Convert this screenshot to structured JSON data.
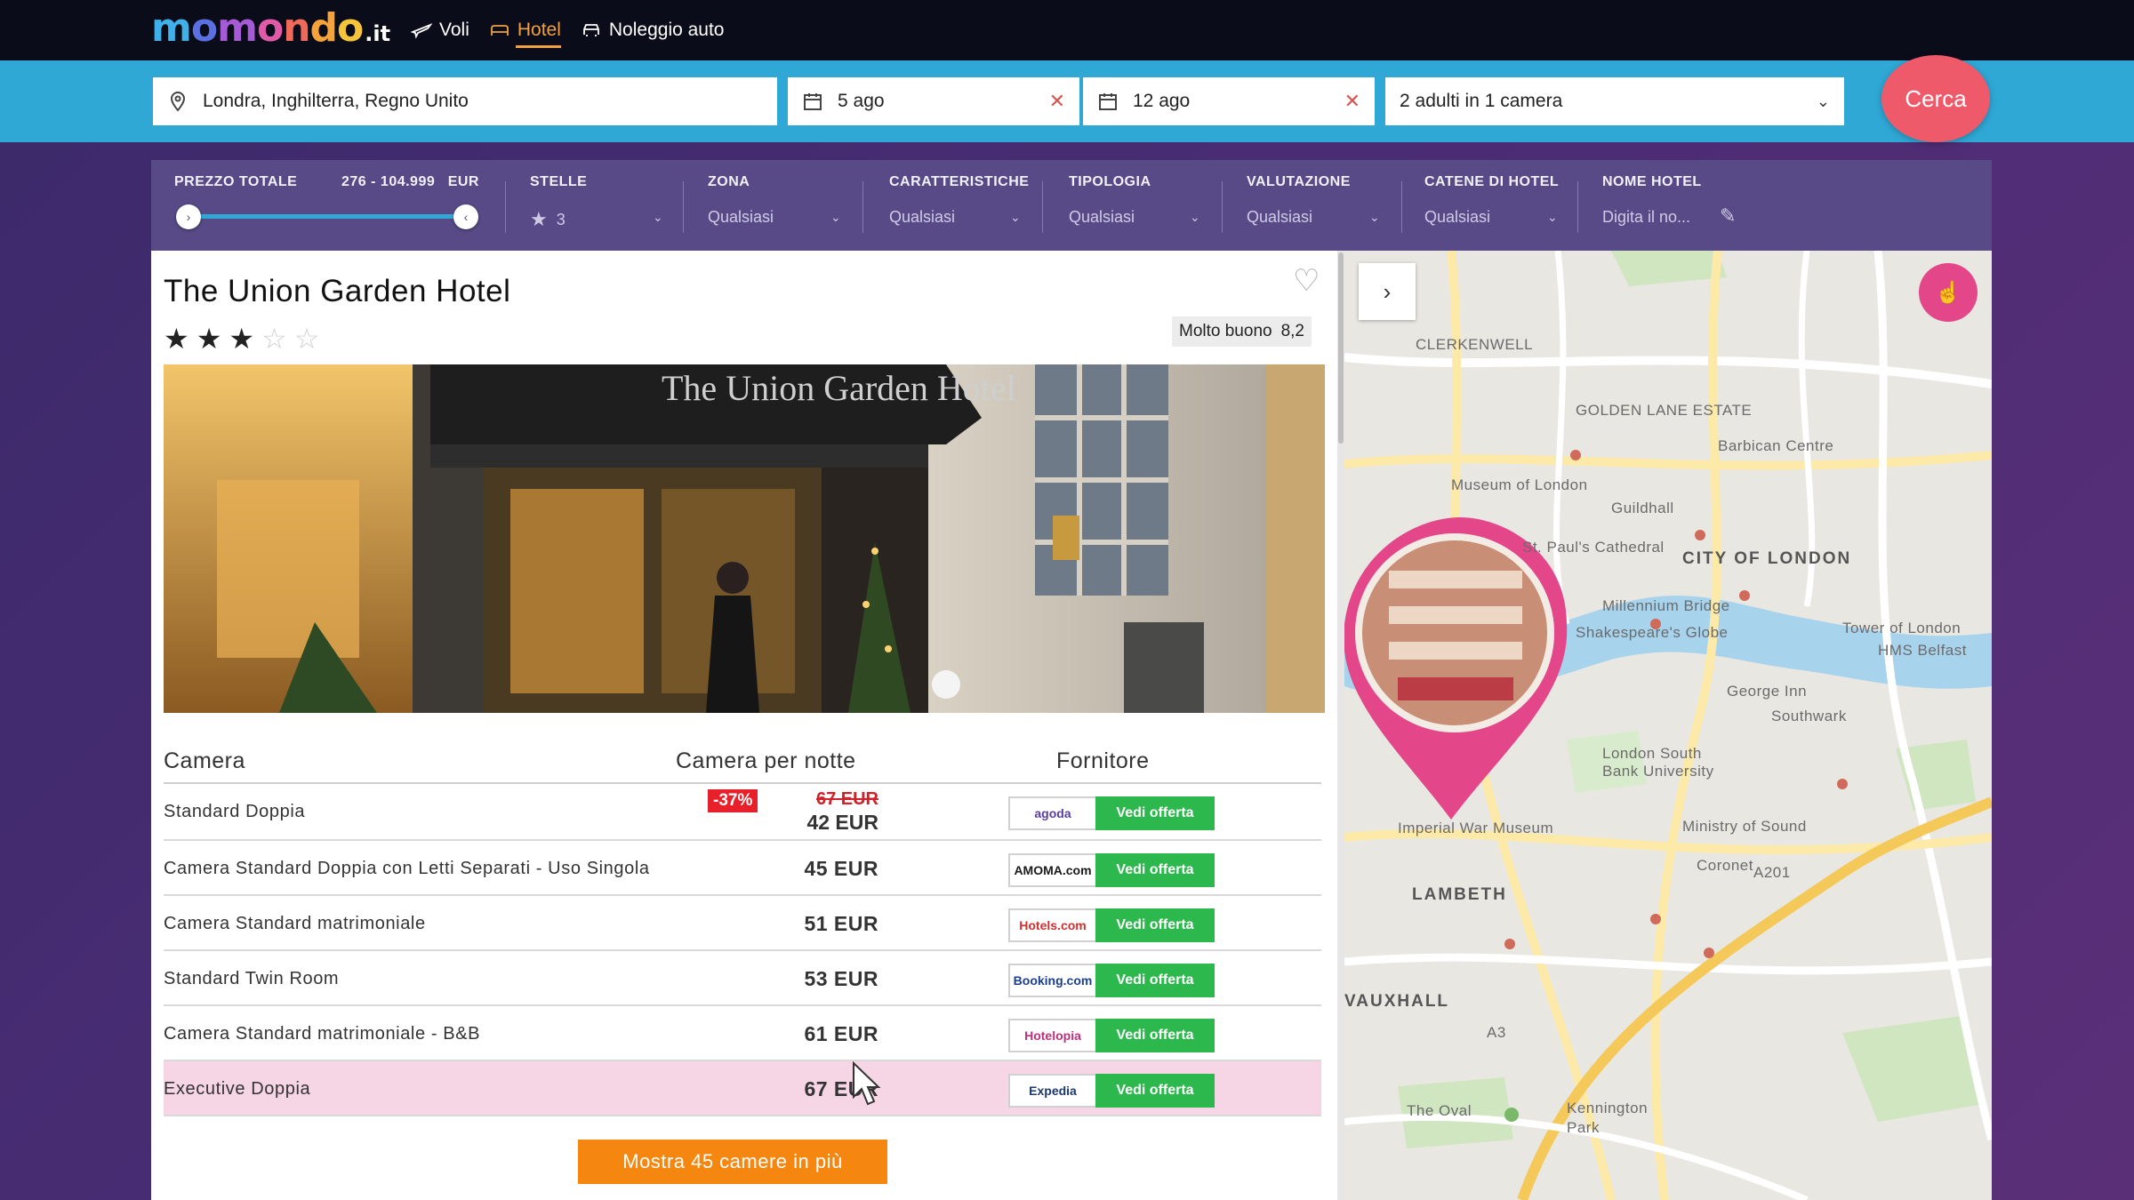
{
  "brand": {
    "logo_main": "momondo",
    "logo_tld": ".it"
  },
  "nav": {
    "items": [
      {
        "label": "Voli",
        "icon": "plane-icon"
      },
      {
        "label": "Hotel",
        "icon": "bed-icon",
        "active": true
      },
      {
        "label": "Noleggio auto",
        "icon": "car-icon"
      }
    ]
  },
  "search": {
    "destination": "Londra, Inghilterra, Regno Unito",
    "checkin": "5 ago",
    "checkout": "12 ago",
    "guests": "2 adulti in 1 camera",
    "button": "Cerca"
  },
  "filters": {
    "price": {
      "label": "PREZZO TOTALE",
      "range": "276 - 104.999",
      "currency": "EUR"
    },
    "stars": {
      "label": "STELLE",
      "value": "3"
    },
    "zone": {
      "label": "ZONA",
      "value": "Qualsiasi"
    },
    "features": {
      "label": "CARATTERISTICHE",
      "value": "Qualsiasi"
    },
    "type": {
      "label": "TIPOLOGIA",
      "value": "Qualsiasi"
    },
    "rating": {
      "label": "VALUTAZIONE",
      "value": "Qualsiasi"
    },
    "chains": {
      "label": "CATENE DI HOTEL",
      "value": "Qualsiasi"
    },
    "name": {
      "label": "NOME HOTEL",
      "placeholder": "Digita il no..."
    }
  },
  "hotel": {
    "name": "The Union Garden Hotel",
    "stars": 3,
    "rating_text": "Molto buono",
    "rating_score": "8,2",
    "sign_text": "The Union Garden Hotel"
  },
  "rooms": {
    "headers": {
      "room": "Camera",
      "price": "Camera per notte",
      "provider": "Fornitore"
    },
    "offer_label": "Vedi offerta",
    "list": [
      {
        "name": "Standard Doppia",
        "discount": "-37%",
        "old_price": "67 EUR",
        "price": "42 EUR",
        "provider": "agoda"
      },
      {
        "name": "Camera Standard Doppia con Letti Separati - Uso Singola",
        "price": "45 EUR",
        "provider": "AMOMA.com"
      },
      {
        "name": "Camera Standard matrimoniale",
        "price": "51 EUR",
        "provider": "Hotels.com"
      },
      {
        "name": "Standard Twin Room",
        "price": "53 EUR",
        "provider": "Booking.com"
      },
      {
        "name": "Camera Standard matrimoniale - B&B",
        "price": "61 EUR",
        "provider": "Hotelopia"
      },
      {
        "name": "Executive Doppia",
        "price": "67 EUR",
        "provider": "Expedia"
      }
    ],
    "more_button": "Mostra 45 camere in più"
  },
  "map": {
    "labels": {
      "clerkenwell": "CLERKENWELL",
      "golden_lane": "GOLDEN LANE ESTATE",
      "barbican": "Barbican Centre",
      "museum_london": "Museum of London",
      "guildhall": "Guildhall",
      "city_london": "CITY OF LONDON",
      "st_pauls": "St. Paul's Cathedral",
      "millennium": "Millennium Bridge",
      "globe": "Shakespeare's Globe",
      "tower": "Tower of London",
      "hms": "HMS Belfast",
      "george_inn": "George Inn",
      "southwark": "Southwark",
      "lsbu": "London South Bank University",
      "ministry": "Ministry of Sound",
      "war_museum": "Imperial War Museum",
      "coronet": "Coronet",
      "lambeth": "LAMBETH",
      "vauxhall": "VAUXHALL",
      "oval": "The Oval",
      "kennington": "Kennington Park",
      "a201": "A201",
      "a3": "A3"
    }
  },
  "colors": {
    "nav_bg": "#0b0c1a",
    "search_bg": "#2fa8d6",
    "filter_bg": "#574a86",
    "accent_orange": "#f5860f",
    "offer_green": "#2db84d",
    "cerca": "#ef5a6a",
    "pin": "#e4468a"
  }
}
